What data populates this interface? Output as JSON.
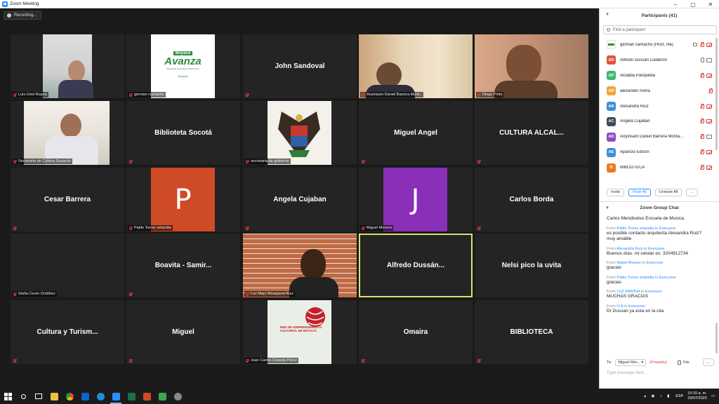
{
  "window": {
    "title": "Zoom Meeting",
    "min": "–",
    "max": "▢",
    "close": "✕"
  },
  "recording": {
    "label": "Recording..."
  },
  "tiles": [
    {
      "label": "",
      "name": "Luis Uriel Rojera"
    },
    {
      "label": "",
      "name": "german camacho",
      "logo": {
        "line1": "Boyacá",
        "line2": "Avanza",
        "line3": "Secretaría de Cultura y Patrimonio",
        "line4": "Boyacá"
      }
    },
    {
      "label": "John Sandoval",
      "name": ""
    },
    {
      "label": "",
      "name": "Anyinsam Daniel Barrera Mont..."
    },
    {
      "label": "",
      "name": "Diego Pinto"
    },
    {
      "label": "",
      "name": "Secretaria de Cultura Susacón"
    },
    {
      "label": "Biblioteta Socotá",
      "name": ""
    },
    {
      "label": "",
      "name": "secretaria de gobierno"
    },
    {
      "label": "Miguel Angel",
      "name": ""
    },
    {
      "label": "CULTURA ALCAL...",
      "name": ""
    },
    {
      "label": "Cesar Barrera",
      "name": ""
    },
    {
      "label": "",
      "name": "Pablo Torres velandia",
      "avatar_letter": "P"
    },
    {
      "label": "Angela Cujaban",
      "name": ""
    },
    {
      "label": "",
      "name": "Miguel Moreno",
      "avatar_letter": "J"
    },
    {
      "label": "Carlos Borda",
      "name": ""
    },
    {
      "label": "",
      "name": "Stella Cerón Ordóñez"
    },
    {
      "label": "Boavita - Samir...",
      "name": ""
    },
    {
      "label": "",
      "name": "Luz Mary Mosquera Ruiz"
    },
    {
      "label": "Alfredo Dussán...",
      "name": ""
    },
    {
      "label": "Nelsi pico la uvita",
      "name": ""
    },
    {
      "label": "Cultura y Turism...",
      "name": ""
    },
    {
      "label": "Miguel",
      "name": ""
    },
    {
      "label": "",
      "name": "Juan Carlos Cepeda Pérez",
      "logo": {
        "line1": "RED DE EMPRENDIMIENTO CULTURAL DE BOYACÁ"
      }
    },
    {
      "label": "Omaira",
      "name": ""
    },
    {
      "label": "BIBLIOTECA",
      "name": ""
    }
  ],
  "participants": {
    "header": "Participants (41)",
    "search_placeholder": "Find a participant",
    "list": [
      {
        "initials": "",
        "name": "german camacho (Host, me)",
        "color": "#ffffff"
      },
      {
        "initials": "AD",
        "name": "Alfredo Dussán Calderón",
        "color": "#e0523b"
      },
      {
        "initials": "AP",
        "name": "Alcaldia Panqueba",
        "color": "#3fb86a"
      },
      {
        "initials": "AR",
        "name": "alexander rivera",
        "color": "#f2a33a"
      },
      {
        "initials": "AR",
        "name": "Alexandra Ruiz",
        "color": "#3c8fd9"
      },
      {
        "initials": "AC",
        "name": "Angela Cujaban",
        "color": "#3d4b5c"
      },
      {
        "initials": "AD",
        "name": "Anyinsam Daniel Barrera Monta...",
        "color": "#8e4cc4"
      },
      {
        "initials": "AE",
        "name": "Aparicio Edison",
        "color": "#3c8fd9"
      },
      {
        "initials": "B",
        "name": "BIBLIOTECA",
        "color": "#f07a1a"
      }
    ],
    "buttons": {
      "invite": "Invite",
      "mute_all": "Mute All",
      "unmute_all": "Unmute All",
      "more": "..."
    }
  },
  "chat": {
    "header": "Zoom Group Chat",
    "messages": [
      {
        "from": "",
        "to": "",
        "text": "Carlos Mendivelso Escuela de Musica."
      },
      {
        "from": "Pablo Torres velandia",
        "to": "Everyone",
        "text": "es posible contacto arquitecta Alexandra Ruiz?\nmuy amable"
      },
      {
        "from": "Alexandra Ruiz",
        "to": "Everyone",
        "text": "Buenos días. mi celular es: 3204912734"
      },
      {
        "from": "Mabel Alvarez",
        "to": "Everyone",
        "text": "gracias"
      },
      {
        "from": "Pablo Torres velandia",
        "to": "Everyone",
        "text": "gracias"
      },
      {
        "from": "LUZ MARINA",
        "to": "Everyone",
        "text": "MUCHAS GRACIAS"
      },
      {
        "from": "O.A",
        "to": "Everyone",
        "text": "Dr Dussan ya esta en la cita"
      }
    ],
    "from_word": "From",
    "to_word": "to",
    "to_label": "To:",
    "recipient": "Miguel Mor... ▾",
    "privately": "(Privately)",
    "file": "File",
    "more": "...",
    "placeholder": "Type message here..."
  },
  "taskbar": {
    "time": "10:10 a. m.",
    "date": "29/07/2020",
    "lang": "ESP"
  }
}
